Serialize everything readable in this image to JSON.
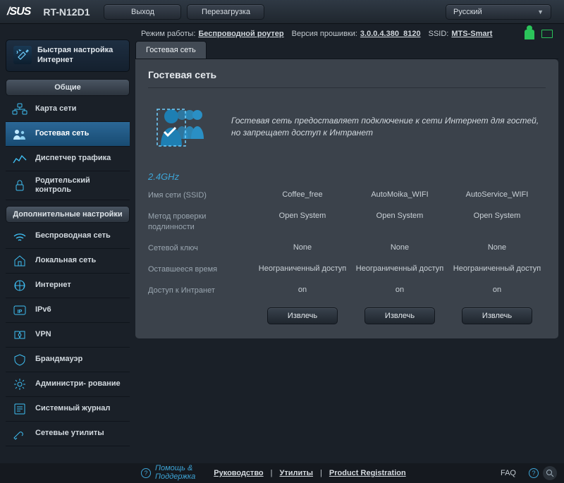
{
  "top": {
    "brand": "/SUS",
    "model": "RT-N12D1",
    "logout": "Выход",
    "reboot": "Перезагрузка",
    "language": "Русский"
  },
  "status": {
    "mode_label": "Режим работы:",
    "mode_value": "Беспроводной роутер",
    "fw_label": "Версия прошивки:",
    "fw_value": "3.0.0.4.380_8120",
    "ssid_label": "SSID:",
    "ssid_value": "MTS-Smart"
  },
  "qis": "Быстрая настройка Интернет",
  "sections": {
    "general": "Общие",
    "advanced": "Дополнительные настройки"
  },
  "nav_general": [
    {
      "id": "netmap",
      "label": "Карта сети"
    },
    {
      "id": "guest",
      "label": "Гостевая сеть"
    },
    {
      "id": "traffic",
      "label": "Диспетчер трафика"
    },
    {
      "id": "parental",
      "label": "Родительский контроль"
    }
  ],
  "nav_advanced": [
    {
      "id": "wireless",
      "label": "Беспроводная сеть"
    },
    {
      "id": "lan",
      "label": "Локальная сеть"
    },
    {
      "id": "wan",
      "label": "Интернет"
    },
    {
      "id": "ipv6",
      "label": "IPv6"
    },
    {
      "id": "vpn",
      "label": "VPN"
    },
    {
      "id": "firewall",
      "label": "Брандмауэр"
    },
    {
      "id": "admin",
      "label": "Администри- рование"
    },
    {
      "id": "syslog",
      "label": "Системный журнал"
    },
    {
      "id": "nettools",
      "label": "Сетевые утилиты"
    }
  ],
  "tabs": {
    "guest": "Гостевая сеть"
  },
  "panel": {
    "title": "Гостевая сеть",
    "intro": "Гостевая сеть предоставляет подключение к сети Интернет для гостей, но запрещает доступ к Интранет",
    "band": "2.4GHz",
    "rows": {
      "ssid": "Имя сети (SSID)",
      "auth": "Метод проверки подлинности",
      "key": "Сетевой ключ",
      "time": "Оставшееся время",
      "intranet": "Доступ к Интранет"
    },
    "guests": [
      {
        "ssid": "Coffee_free",
        "auth": "Open System",
        "key": "None",
        "time": "Неограниченный доступ",
        "intranet": "on"
      },
      {
        "ssid": "AutoMoika_WIFI",
        "auth": "Open System",
        "key": "None",
        "time": "Неограниченный доступ",
        "intranet": "on"
      },
      {
        "ssid": "AutoService_WIFI",
        "auth": "Open System",
        "key": "None",
        "time": "Неограниченный доступ",
        "intranet": "on"
      }
    ],
    "evict": "Извлечь"
  },
  "footer": {
    "help1": "Помощь &",
    "help2": "Поддержка",
    "manual": "Руководство",
    "utility": "Утилиты",
    "product_reg": "Product Registration",
    "faq": "FAQ"
  }
}
